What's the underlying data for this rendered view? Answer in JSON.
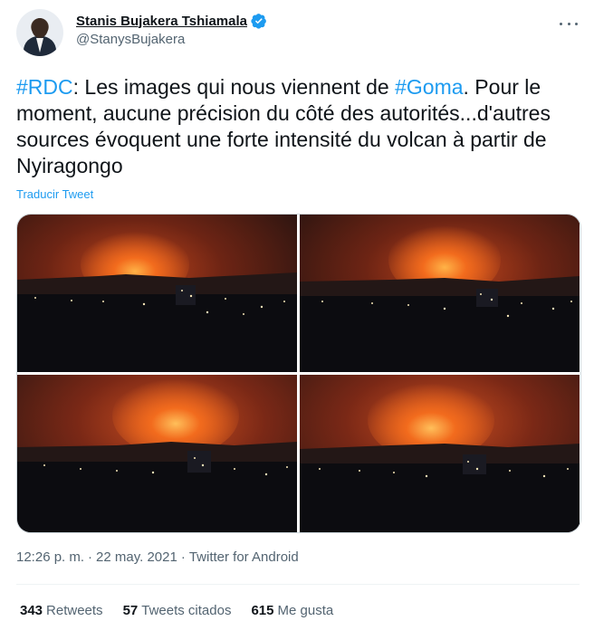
{
  "author": {
    "display_name": "Stanis Bujakera Tshiamala",
    "handle": "@StanysBujakera",
    "verified": true
  },
  "tweet": {
    "parts": [
      {
        "type": "hashtag",
        "text": "#RDC"
      },
      {
        "type": "text",
        "text": ": Les images qui nous viennent de "
      },
      {
        "type": "hashtag",
        "text": "#Goma"
      },
      {
        "type": "text",
        "text": ". Pour le moment, aucune précision du côté des autorités...d'autres sources évoquent une forte intensité du volcan à partir de Nyiragongo"
      }
    ],
    "translate_label": "Traducir Tweet"
  },
  "media": {
    "count": 4,
    "photos": [
      {
        "description_icon": "volcano-night-photo"
      },
      {
        "description_icon": "volcano-night-photo"
      },
      {
        "description_icon": "volcano-night-photo"
      },
      {
        "description_icon": "volcano-night-photo"
      }
    ]
  },
  "meta": {
    "time": "12:26 p. m.",
    "separator": "·",
    "date": "22 may. 2021",
    "source": "Twitter for Android"
  },
  "stats": {
    "retweets_count": "343",
    "retweets_label": "Retweets",
    "quotes_count": "57",
    "quotes_label": "Tweets citados",
    "likes_count": "615",
    "likes_label": "Me gusta"
  },
  "colors": {
    "accent": "#1d9bf0",
    "text": "#0f1419",
    "secondary": "#536471",
    "border": "#cfd9de"
  },
  "icons": {
    "verified": "verified-badge-icon",
    "more": "more-options-icon"
  }
}
